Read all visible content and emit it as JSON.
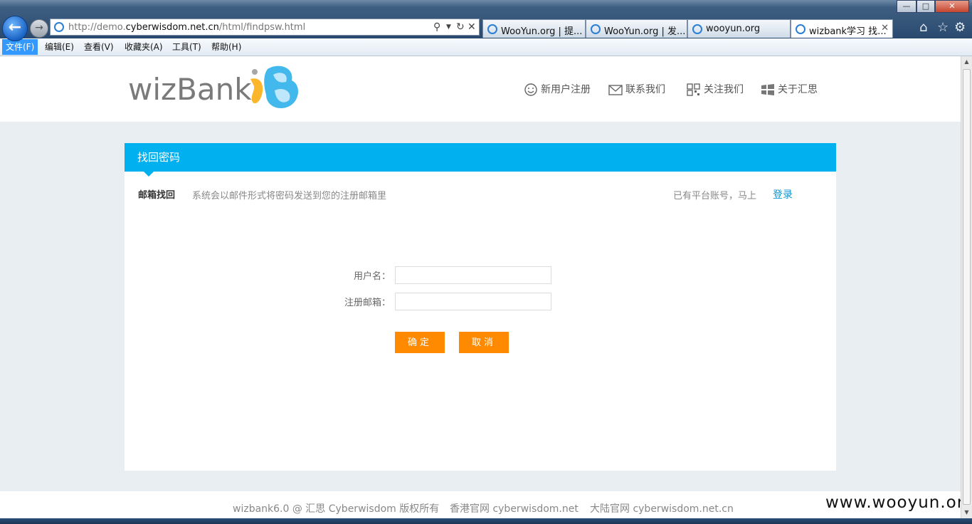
{
  "browser": {
    "url_prefix": "http://demo.",
    "url_host": "cyberwisdom.net.cn",
    "url_path": "/html/findpsw.html",
    "tabs": [
      {
        "label": "WooYun.org | 提..."
      },
      {
        "label": "WooYun.org | 发..."
      },
      {
        "label": "wooyun.org"
      },
      {
        "label": "wizbank学习 找..."
      }
    ],
    "menu": [
      "文件(F)",
      "编辑(E)",
      "查看(V)",
      "收藏夹(A)",
      "工具(T)",
      "帮助(H)"
    ]
  },
  "header": {
    "logo_text": "wizBank",
    "links": [
      "新用户注册",
      "联系我们",
      "关注我们",
      "关于汇思"
    ]
  },
  "card": {
    "title": "找回密码",
    "mode_label": "邮箱找回",
    "mode_desc": "系统会以邮件形式将密码发送到您的注册邮箱里",
    "has_account": "已有平台账号，马上",
    "login_link": "登录",
    "username_label": "用户名：",
    "email_label": "注册邮箱：",
    "username_value": "",
    "email_value": "",
    "confirm_button": "确定",
    "cancel_button": "取消"
  },
  "footer": {
    "copyright": "wizbank6.0 @ 汇思 Cyberwisdom 版权所有",
    "hk_site": "香港官网 cyberwisdom.net",
    "cn_site": "大陆官网 cyberwisdom.net.cn"
  },
  "watermark": "www.wooyun.org",
  "colors": {
    "accent_blue": "#00b0ef",
    "button_orange": "#ff8a00",
    "link_blue": "#0b95d0"
  }
}
